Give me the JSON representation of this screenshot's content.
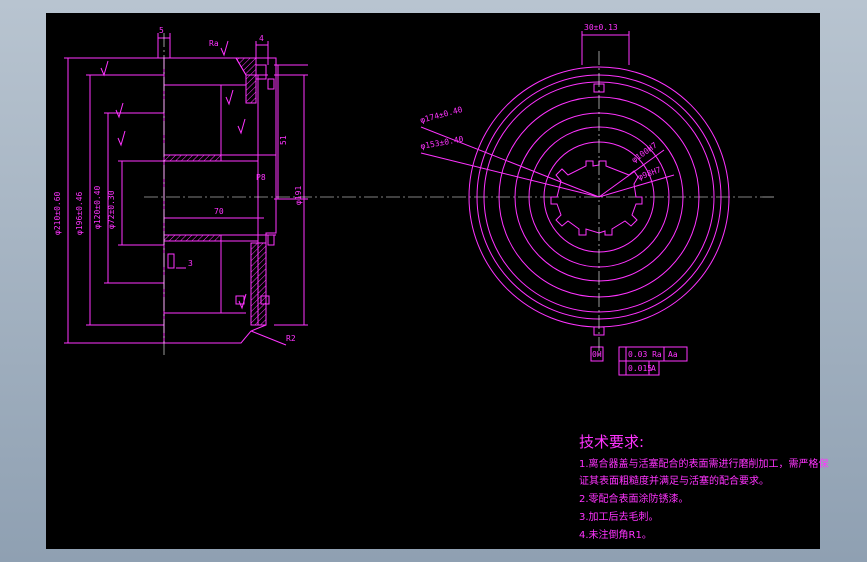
{
  "colors": {
    "line": "#ff33ff",
    "axis": "#ffffff",
    "background": "#000000",
    "frame": "#9fb0c2"
  },
  "tech": {
    "title": "技术要求:",
    "lines": [
      "1.离合器盖与活塞配合的表面需进行磨削加工，需严格保",
      "证其表面粗糙度并满足与活塞的配合要求。",
      "2.零配合表面涂防锈漆。",
      "3.加工后去毛刺。",
      "4.未注倒角R1。"
    ]
  },
  "dims": {
    "d210": "φ210±0.60",
    "d196": "φ196±0.46",
    "d120": "φ120±0.40",
    "d72": "φ72±0.30",
    "d5": "5",
    "d4": "4",
    "d3": "3",
    "d70": "70",
    "d51": "51",
    "d191": "φ191",
    "p8": "P8",
    "r2": "R2",
    "width": "30±0.13",
    "c174": "φ174±0.40",
    "c153": "φ153±0.40",
    "c100": "φ100H7",
    "c98": "φ98H7",
    "tol1": "0.03 Ra",
    "tol1_ref": "Aa",
    "tol2": "0.015",
    "tol2_ref": "A",
    "datum": "0H",
    "roughness": "Ra"
  }
}
